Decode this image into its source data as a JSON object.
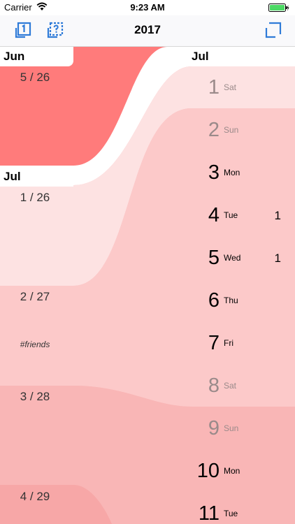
{
  "status_bar": {
    "carrier": "Carrier",
    "time": "9:23 AM"
  },
  "nav": {
    "title": "2017"
  },
  "left": {
    "month1": "Jun",
    "month2": "Jul",
    "weeks": [
      "5 / 26",
      "1 / 26",
      "2 / 27",
      "3 / 28",
      "4 / 29"
    ],
    "tag": "#friends"
  },
  "right": {
    "month": "Jul",
    "days": [
      {
        "num": "1",
        "name": "Sat",
        "count": ""
      },
      {
        "num": "2",
        "name": "Sun",
        "count": ""
      },
      {
        "num": "3",
        "name": "Mon",
        "count": ""
      },
      {
        "num": "4",
        "name": "Tue",
        "count": "1"
      },
      {
        "num": "5",
        "name": "Wed",
        "count": "1"
      },
      {
        "num": "6",
        "name": "Thu",
        "count": ""
      },
      {
        "num": "7",
        "name": "Fri",
        "count": ""
      },
      {
        "num": "8",
        "name": "Sat",
        "count": ""
      },
      {
        "num": "9",
        "name": "Sun",
        "count": ""
      },
      {
        "num": "10",
        "name": "Mon",
        "count": ""
      },
      {
        "num": "11",
        "name": "Tue",
        "count": ""
      }
    ]
  },
  "colors": {
    "accent": "#2f7bd8",
    "band_salmon": "#ff7b7b",
    "band_light": "#fde3e3",
    "band_mid": "#fcd0d0",
    "band_deep": "#f9b9b9"
  },
  "icons": [
    "wifi-icon",
    "battery-icon",
    "today-icon",
    "question-icon",
    "fullscreen-icon"
  ]
}
